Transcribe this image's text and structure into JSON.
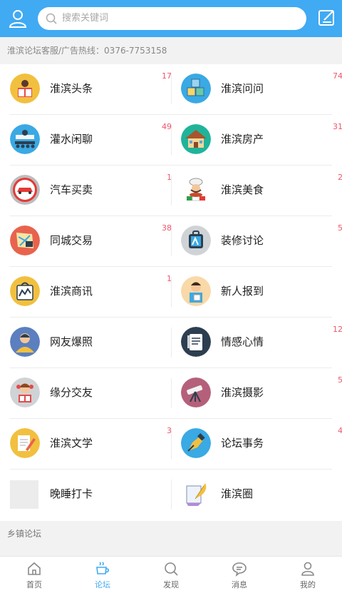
{
  "search": {
    "placeholder": "搜索关键词"
  },
  "notice": "淮滨论坛客服/广告热线：0376-7753158",
  "forums": [
    {
      "label": "淮滨头条",
      "count": "17",
      "icon": "reading-person-icon"
    },
    {
      "label": "淮滨问问",
      "count": "74",
      "icon": "abc-blocks-icon"
    },
    {
      "label": "灌水闲聊",
      "count": "49",
      "icon": "desk-chat-icon"
    },
    {
      "label": "淮滨房产",
      "count": "31",
      "icon": "house-icon"
    },
    {
      "label": "汽车买卖",
      "count": "1",
      "icon": "car-icon"
    },
    {
      "label": "淮滨美食",
      "count": "2",
      "icon": "chef-icon"
    },
    {
      "label": "同城交易",
      "count": "38",
      "icon": "map-icon"
    },
    {
      "label": "装修讨论",
      "count": "5",
      "icon": "paint-bag-icon"
    },
    {
      "label": "淮滨商讯",
      "count": "1",
      "icon": "shopping-bag-icon"
    },
    {
      "label": "新人报到",
      "count": "",
      "icon": "newcomer-icon"
    },
    {
      "label": "网友爆照",
      "count": "",
      "icon": "person-photo-icon"
    },
    {
      "label": "情感心情",
      "count": "12",
      "icon": "note-icon"
    },
    {
      "label": "缘分交友",
      "count": "",
      "icon": "girl-reading-icon"
    },
    {
      "label": "淮滨摄影",
      "count": "5",
      "icon": "telescope-icon"
    },
    {
      "label": "淮滨文学",
      "count": "3",
      "icon": "pencil-paper-icon"
    },
    {
      "label": "论坛事务",
      "count": "4",
      "icon": "pen-nib-icon"
    },
    {
      "label": "晚睡打卡",
      "count": "",
      "icon": "placeholder-icon"
    },
    {
      "label": "淮滨圈",
      "count": "",
      "icon": "quill-paper-icon"
    }
  ],
  "section_title": "乡镇论坛",
  "tabs": [
    {
      "label": "首页",
      "icon": "home-icon"
    },
    {
      "label": "论坛",
      "icon": "coffee-cup-icon"
    },
    {
      "label": "发现",
      "icon": "search-icon"
    },
    {
      "label": "消息",
      "icon": "message-icon"
    },
    {
      "label": "我的",
      "icon": "profile-icon"
    }
  ],
  "colors": {
    "accent": "#40aaf3",
    "badge": "#f0566a"
  }
}
